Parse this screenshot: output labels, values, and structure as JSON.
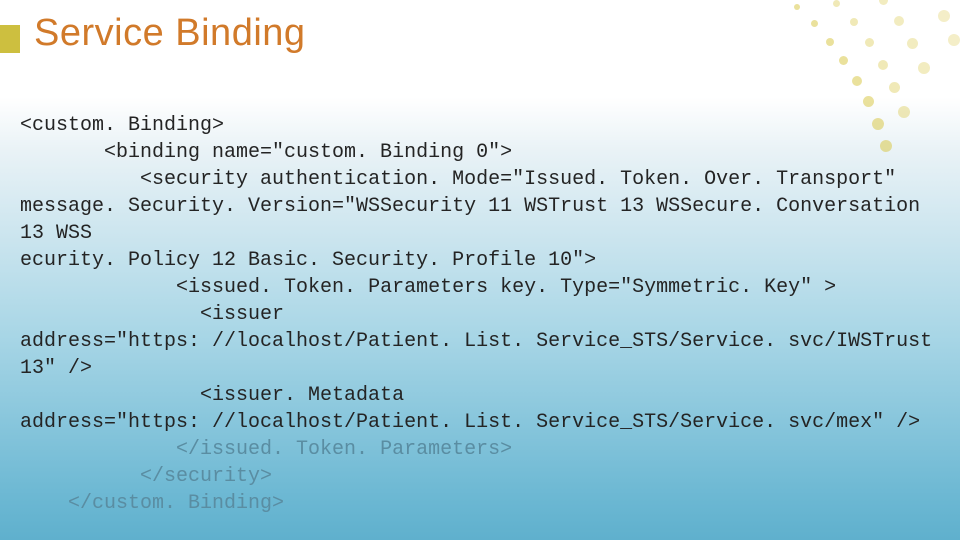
{
  "title": "Service Binding",
  "code": {
    "l1": "<custom. Binding>",
    "l2": "       <binding name=\"custom. Binding 0\">",
    "l3": "          <security authentication. Mode=\"Issued. Token. Over. Transport\"",
    "l4": "message. Security. Version=\"WSSecurity 11 WSTrust 13 WSSecure. Conversation 13 WSS",
    "l5": "ecurity. Policy 12 Basic. Security. Profile 10\">",
    "l6": "             <issued. Token. Parameters key. Type=\"Symmetric. Key\" >",
    "l7": "               <issuer",
    "l8": "address=\"https: //localhost/Patient. List. Service_STS/Service. svc/IWSTrust",
    "l9": "13\" />",
    "l10": "               <issuer. Metadata",
    "l11": "address=\"https: //localhost/Patient. List. Service_STS/Service. svc/mex\" />",
    "l12": "             </issued. Token. Parameters>",
    "l13": "          </security>",
    "l14": "    </custom. Binding>"
  }
}
